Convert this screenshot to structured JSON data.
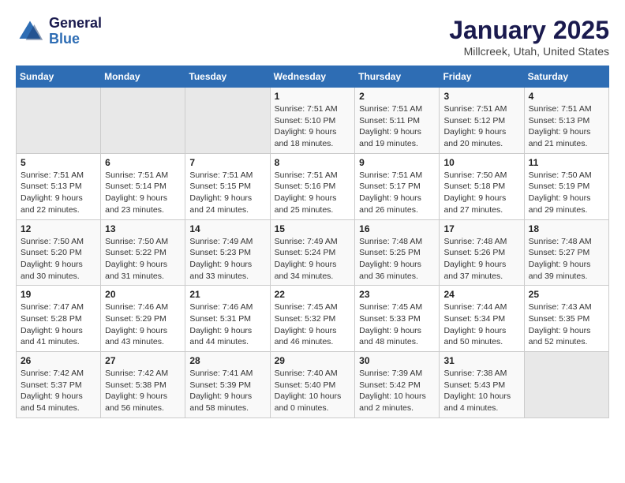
{
  "header": {
    "logo_line1": "General",
    "logo_line2": "Blue",
    "title": "January 2025",
    "subtitle": "Millcreek, Utah, United States"
  },
  "weekdays": [
    "Sunday",
    "Monday",
    "Tuesday",
    "Wednesday",
    "Thursday",
    "Friday",
    "Saturday"
  ],
  "weeks": [
    [
      {
        "day": "",
        "info": ""
      },
      {
        "day": "",
        "info": ""
      },
      {
        "day": "",
        "info": ""
      },
      {
        "day": "1",
        "info": "Sunrise: 7:51 AM\nSunset: 5:10 PM\nDaylight: 9 hours\nand 18 minutes."
      },
      {
        "day": "2",
        "info": "Sunrise: 7:51 AM\nSunset: 5:11 PM\nDaylight: 9 hours\nand 19 minutes."
      },
      {
        "day": "3",
        "info": "Sunrise: 7:51 AM\nSunset: 5:12 PM\nDaylight: 9 hours\nand 20 minutes."
      },
      {
        "day": "4",
        "info": "Sunrise: 7:51 AM\nSunset: 5:13 PM\nDaylight: 9 hours\nand 21 minutes."
      }
    ],
    [
      {
        "day": "5",
        "info": "Sunrise: 7:51 AM\nSunset: 5:13 PM\nDaylight: 9 hours\nand 22 minutes."
      },
      {
        "day": "6",
        "info": "Sunrise: 7:51 AM\nSunset: 5:14 PM\nDaylight: 9 hours\nand 23 minutes."
      },
      {
        "day": "7",
        "info": "Sunrise: 7:51 AM\nSunset: 5:15 PM\nDaylight: 9 hours\nand 24 minutes."
      },
      {
        "day": "8",
        "info": "Sunrise: 7:51 AM\nSunset: 5:16 PM\nDaylight: 9 hours\nand 25 minutes."
      },
      {
        "day": "9",
        "info": "Sunrise: 7:51 AM\nSunset: 5:17 PM\nDaylight: 9 hours\nand 26 minutes."
      },
      {
        "day": "10",
        "info": "Sunrise: 7:50 AM\nSunset: 5:18 PM\nDaylight: 9 hours\nand 27 minutes."
      },
      {
        "day": "11",
        "info": "Sunrise: 7:50 AM\nSunset: 5:19 PM\nDaylight: 9 hours\nand 29 minutes."
      }
    ],
    [
      {
        "day": "12",
        "info": "Sunrise: 7:50 AM\nSunset: 5:20 PM\nDaylight: 9 hours\nand 30 minutes."
      },
      {
        "day": "13",
        "info": "Sunrise: 7:50 AM\nSunset: 5:22 PM\nDaylight: 9 hours\nand 31 minutes."
      },
      {
        "day": "14",
        "info": "Sunrise: 7:49 AM\nSunset: 5:23 PM\nDaylight: 9 hours\nand 33 minutes."
      },
      {
        "day": "15",
        "info": "Sunrise: 7:49 AM\nSunset: 5:24 PM\nDaylight: 9 hours\nand 34 minutes."
      },
      {
        "day": "16",
        "info": "Sunrise: 7:48 AM\nSunset: 5:25 PM\nDaylight: 9 hours\nand 36 minutes."
      },
      {
        "day": "17",
        "info": "Sunrise: 7:48 AM\nSunset: 5:26 PM\nDaylight: 9 hours\nand 37 minutes."
      },
      {
        "day": "18",
        "info": "Sunrise: 7:48 AM\nSunset: 5:27 PM\nDaylight: 9 hours\nand 39 minutes."
      }
    ],
    [
      {
        "day": "19",
        "info": "Sunrise: 7:47 AM\nSunset: 5:28 PM\nDaylight: 9 hours\nand 41 minutes."
      },
      {
        "day": "20",
        "info": "Sunrise: 7:46 AM\nSunset: 5:29 PM\nDaylight: 9 hours\nand 43 minutes."
      },
      {
        "day": "21",
        "info": "Sunrise: 7:46 AM\nSunset: 5:31 PM\nDaylight: 9 hours\nand 44 minutes."
      },
      {
        "day": "22",
        "info": "Sunrise: 7:45 AM\nSunset: 5:32 PM\nDaylight: 9 hours\nand 46 minutes."
      },
      {
        "day": "23",
        "info": "Sunrise: 7:45 AM\nSunset: 5:33 PM\nDaylight: 9 hours\nand 48 minutes."
      },
      {
        "day": "24",
        "info": "Sunrise: 7:44 AM\nSunset: 5:34 PM\nDaylight: 9 hours\nand 50 minutes."
      },
      {
        "day": "25",
        "info": "Sunrise: 7:43 AM\nSunset: 5:35 PM\nDaylight: 9 hours\nand 52 minutes."
      }
    ],
    [
      {
        "day": "26",
        "info": "Sunrise: 7:42 AM\nSunset: 5:37 PM\nDaylight: 9 hours\nand 54 minutes."
      },
      {
        "day": "27",
        "info": "Sunrise: 7:42 AM\nSunset: 5:38 PM\nDaylight: 9 hours\nand 56 minutes."
      },
      {
        "day": "28",
        "info": "Sunrise: 7:41 AM\nSunset: 5:39 PM\nDaylight: 9 hours\nand 58 minutes."
      },
      {
        "day": "29",
        "info": "Sunrise: 7:40 AM\nSunset: 5:40 PM\nDaylight: 10 hours\nand 0 minutes."
      },
      {
        "day": "30",
        "info": "Sunrise: 7:39 AM\nSunset: 5:42 PM\nDaylight: 10 hours\nand 2 minutes."
      },
      {
        "day": "31",
        "info": "Sunrise: 7:38 AM\nSunset: 5:43 PM\nDaylight: 10 hours\nand 4 minutes."
      },
      {
        "day": "",
        "info": ""
      }
    ]
  ]
}
